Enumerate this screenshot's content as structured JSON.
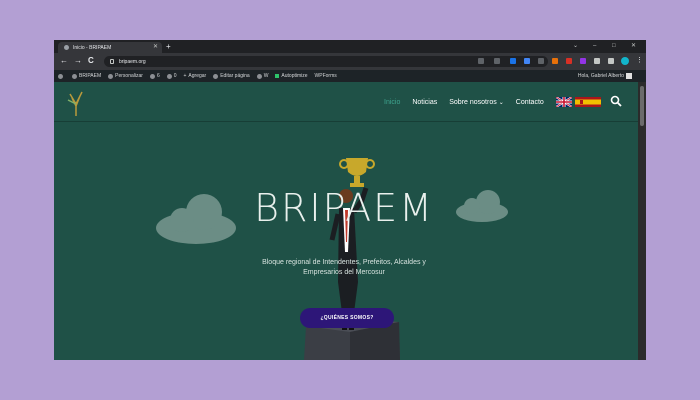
{
  "browser": {
    "tab_title": "Inicio - BRIPAEM",
    "url": "bripaem.org",
    "new_tab": "+",
    "win_min": "–",
    "win_max": "□",
    "win_close": "✕",
    "back": "←",
    "forward": "→",
    "reload": "C"
  },
  "adminbar": {
    "items": [
      {
        "label": "BRIPAEM"
      },
      {
        "label": "Personalizar"
      },
      {
        "label": "6"
      },
      {
        "label": "0"
      },
      {
        "label": "Agregar"
      },
      {
        "label": "Editar página"
      },
      {
        "label": "W"
      },
      {
        "label": "Autoptimize"
      },
      {
        "label": "WPForms"
      }
    ],
    "howdy": "Hola, Gabriel Alberto"
  },
  "site": {
    "nav": [
      {
        "label": "Inicio",
        "active": true
      },
      {
        "label": "Noticias"
      },
      {
        "label": "Sobre nosotros",
        "chevron": "⌄"
      },
      {
        "label": "Contacto"
      }
    ],
    "hero_title": "BRIPAEM",
    "hero_subtitle": "Bloque regional de Intendentes, Prefeitos, Alcaldes y Empresarios del Mercosur",
    "cta": "¿QUIÉNES SOMOS?",
    "colors": {
      "background": "#1f5147",
      "cta": "#2d1678",
      "nav_active": "#3ea58f"
    }
  },
  "icons": {
    "search": "search-icon",
    "flag_uk": "uk-flag-icon",
    "flag_es": "spain-flag-icon"
  }
}
